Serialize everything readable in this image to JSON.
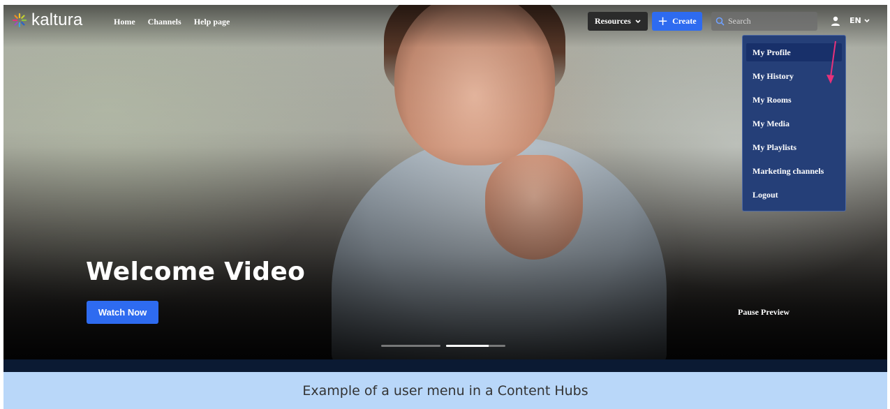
{
  "header": {
    "brand": "kaltura",
    "nav": [
      "Home",
      "Channels",
      "Help page"
    ],
    "resources_label": "Resources",
    "create_label": "Create",
    "search_placeholder": "Search",
    "language": "EN"
  },
  "user_menu": {
    "items": [
      "My Profile",
      "My History",
      "My Rooms",
      "My Media",
      "My Playlists",
      "Marketing channels",
      "Logout"
    ],
    "active_index": 0
  },
  "hero": {
    "title": "Welcome Video",
    "watch_label": "Watch Now",
    "pause_label": "Pause Preview",
    "slides": [
      {
        "active": false,
        "progress": 0
      },
      {
        "active": true,
        "progress": 0.72
      }
    ]
  },
  "caption": "Example of a user menu in a Content Hubs",
  "colors": {
    "accent": "#2e6bf0",
    "menu_bg": "#253f78",
    "menu_active": "#18306a",
    "annotation_arrow": "#e8317a",
    "caption_bg": "#b9d7f9"
  }
}
